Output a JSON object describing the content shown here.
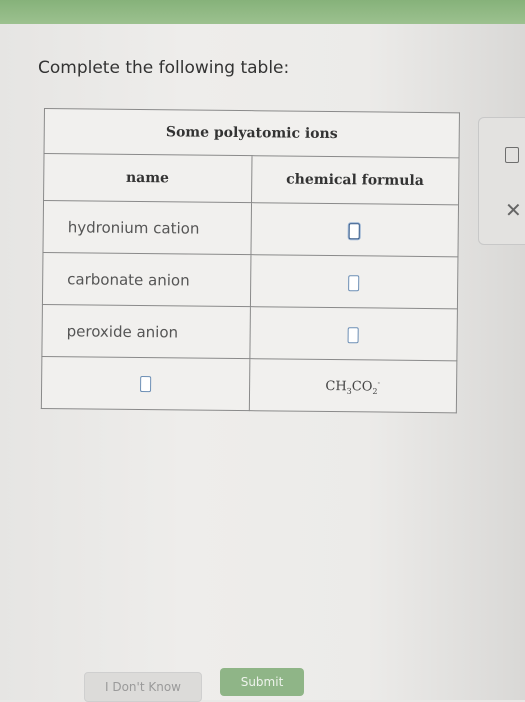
{
  "prompt": "Complete the following table:",
  "table": {
    "title": "Some polyatomic ions",
    "headers": {
      "name": "name",
      "formula": "chemical formula"
    },
    "rows": [
      {
        "name": "hydronium cation",
        "formula": ""
      },
      {
        "name": "carbonate anion",
        "formula": ""
      },
      {
        "name": "peroxide anion",
        "formula": ""
      },
      {
        "name": "",
        "formula_text": "CH3CO2-"
      }
    ]
  },
  "formula_parts": {
    "a": "CH",
    "a_sub": "3",
    "b": "CO",
    "b_sub": "2",
    "charge": "-"
  },
  "buttons": {
    "dont_know": "I Don't Know",
    "submit": "Submit"
  },
  "colors": {
    "top_bar": "#9cc18f",
    "submit": "#8fb587",
    "answer_box": "#6d8fb5"
  }
}
